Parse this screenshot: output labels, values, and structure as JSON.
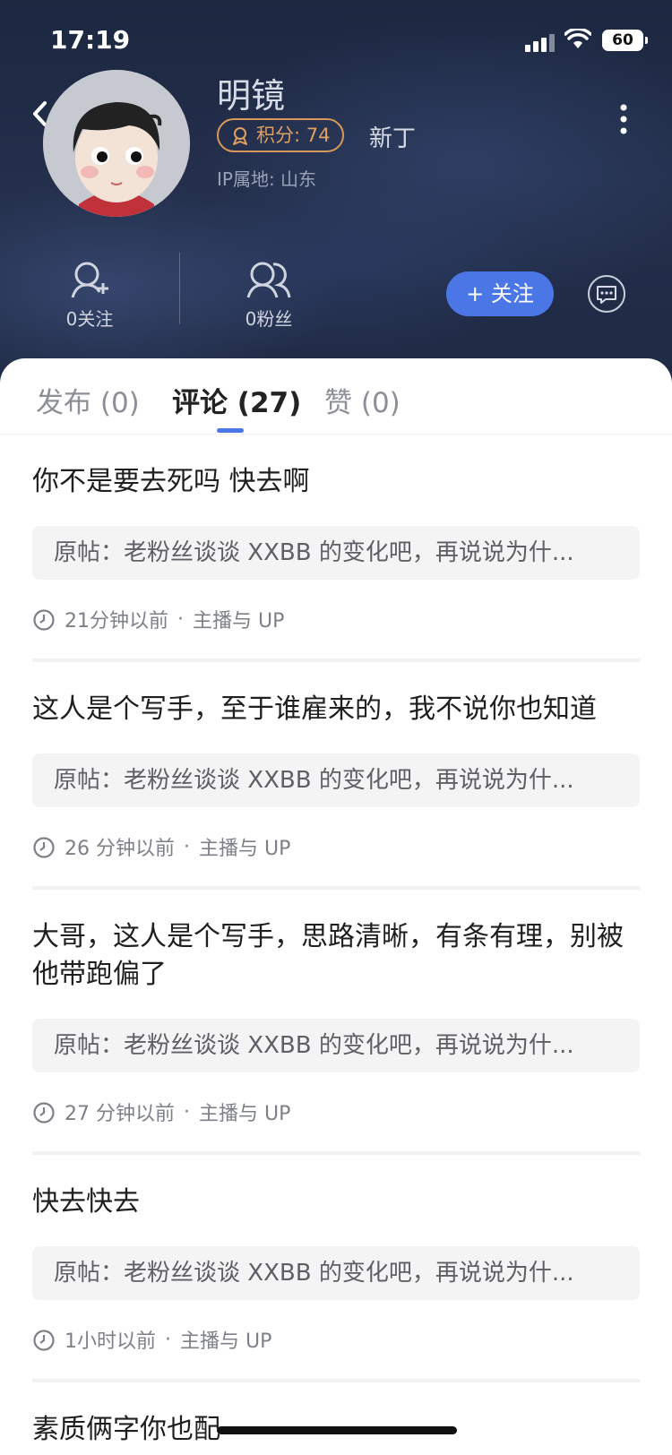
{
  "status_bar": {
    "time": "17:19",
    "battery": "60"
  },
  "profile": {
    "username": "明镜",
    "points_label": "积分: 74",
    "rank": "新丁",
    "ip_location": "IP属地: 山东",
    "following_label": "0关注",
    "followers_label": "0粉丝",
    "follow_button": "+ 关注"
  },
  "tabs": [
    {
      "label": "发布 (0)",
      "active": false
    },
    {
      "label": "评论 (27)",
      "active": true
    },
    {
      "label": "赞 (0)",
      "active": false
    }
  ],
  "comments": [
    {
      "text": "你不是要去死吗 快去啊",
      "original_post": "原帖：老粉丝谈谈 XXBB 的变化吧，再说说为什...",
      "time": "21分钟以前",
      "category": "主播与 UP"
    },
    {
      "text": "这人是个写手，至于谁雇来的，我不说你也知道",
      "original_post": "原帖：老粉丝谈谈 XXBB 的变化吧，再说说为什...",
      "time": "26 分钟以前",
      "category": "主播与 UP"
    },
    {
      "text": "大哥，这人是个写手，思路清晰，有条有理，别被他带跑偏了",
      "original_post": "原帖：老粉丝谈谈 XXBB 的变化吧，再说说为什...",
      "time": "27 分钟以前",
      "category": "主播与 UP"
    },
    {
      "text": "快去快去",
      "original_post": "原帖：老粉丝谈谈 XXBB 的变化吧，再说说为什...",
      "time": "1小时以前",
      "category": "主播与 UP"
    },
    {
      "text": "素质俩字你也配"
    }
  ],
  "colors": {
    "accent": "#4b77e6",
    "badge": "#e0a062",
    "header_bg": "#1f2a44"
  }
}
